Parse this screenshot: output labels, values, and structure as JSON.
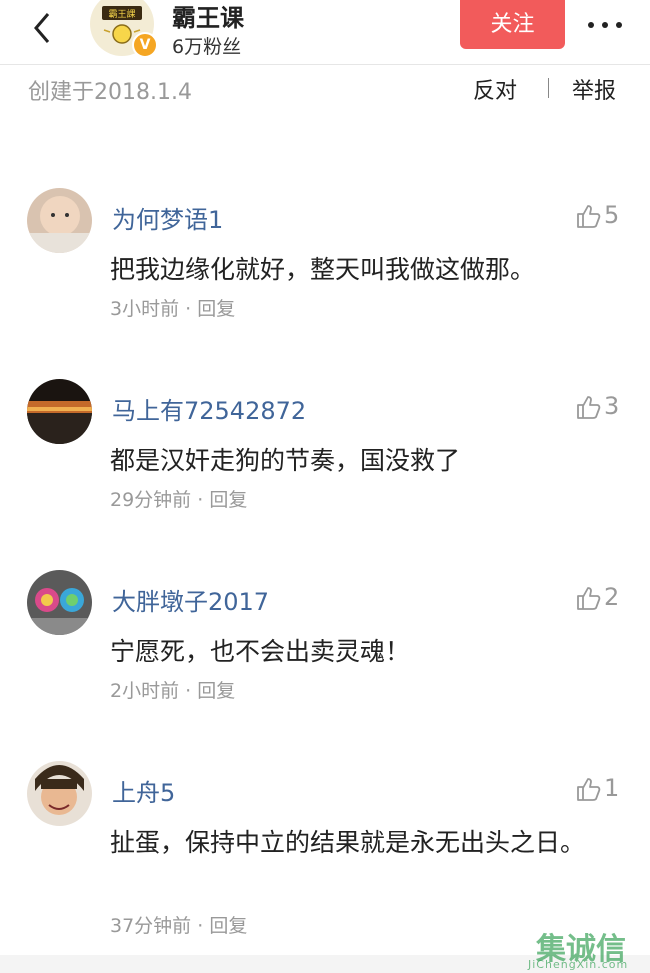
{
  "header": {
    "account_name": "霸王课",
    "fans": "6万粉丝",
    "follow_label": "关注",
    "logo_text": "霸王課",
    "verified_badge": "V",
    "accent_color": "#f25b5b"
  },
  "subbar": {
    "created": "创建于2018.1.4",
    "oppose_label": "反对",
    "report_label": "举报"
  },
  "comments": [
    {
      "user": "为何梦语1",
      "likes": "5",
      "text": "把我边缘化就好，整天叫我做这做那。",
      "time": "3小时前",
      "reply": "回复"
    },
    {
      "user": "马上有72542872",
      "likes": "3",
      "text": "都是汉奸走狗的节奏，国没救了",
      "time": "29分钟前",
      "reply": "回复"
    },
    {
      "user": "大胖墩子2017",
      "likes": "2",
      "text": "宁愿死，也不会出卖灵魂！",
      "time": "2小时前",
      "reply": "回复"
    },
    {
      "user": "上舟5",
      "likes": "1",
      "text": "扯蛋，保持中立的结果就是永无出头之日。",
      "time": "37分钟前",
      "reply": "回复"
    }
  ],
  "meta_separator": " · ",
  "watermark": {
    "text": "集诚信",
    "sub": "JiChengXin.com"
  },
  "icons": [
    "back-arrow-icon",
    "more-dots-icon",
    "thumbs-up-icon"
  ]
}
